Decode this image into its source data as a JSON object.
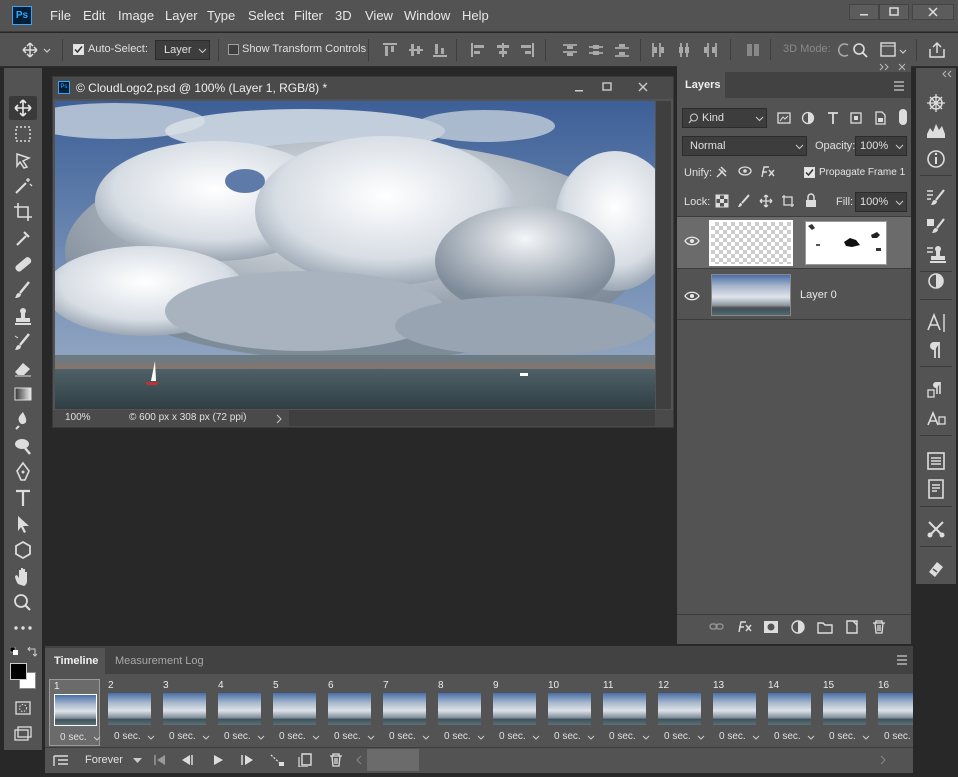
{
  "app": {
    "logo": "Ps"
  },
  "menubar": {
    "items": [
      "File",
      "Edit",
      "Image",
      "Layer",
      "Type",
      "Select",
      "Filter",
      "3D",
      "View",
      "Window",
      "Help"
    ]
  },
  "window_controls": {
    "minimize": "minimize-icon",
    "maximize": "maximize-icon",
    "close": "close-icon"
  },
  "options_bar": {
    "auto_select_label": "Auto-Select:",
    "auto_select_checked": true,
    "auto_select_target": "Layer",
    "show_transform_label": "Show Transform Controls",
    "mode_3d_label": "3D Mode:"
  },
  "document": {
    "title": "© CloudLogo2.psd @ 100% (Layer 1, RGB/8) *",
    "zoom": "100%",
    "info": "© 600 px x 308 px (72 ppi)"
  },
  "layers_panel": {
    "tab": "Layers",
    "filter_kind": "Kind",
    "blend_mode": "Normal",
    "opacity_label": "Opacity:",
    "opacity_value": "100%",
    "unify_label": "Unify:",
    "propagate_label": "Propagate Frame 1",
    "propagate_checked": true,
    "lock_label": "Lock:",
    "fill_label": "Fill:",
    "fill_value": "100%",
    "layers": [
      {
        "name": "",
        "visible": true,
        "has_mask": true,
        "selected": true
      },
      {
        "name": "Layer 0",
        "visible": true,
        "has_mask": false,
        "selected": false
      }
    ]
  },
  "timeline": {
    "tabs": [
      "Timeline",
      "Measurement Log"
    ],
    "active_tab": "Timeline",
    "loop": "Forever",
    "frames": [
      {
        "num": "1",
        "time": "0 sec."
      },
      {
        "num": "2",
        "time": "0 sec."
      },
      {
        "num": "3",
        "time": "0 sec."
      },
      {
        "num": "4",
        "time": "0 sec."
      },
      {
        "num": "5",
        "time": "0 sec."
      },
      {
        "num": "6",
        "time": "0 sec."
      },
      {
        "num": "7",
        "time": "0 sec."
      },
      {
        "num": "8",
        "time": "0 sec."
      },
      {
        "num": "9",
        "time": "0 sec."
      },
      {
        "num": "10",
        "time": "0 sec."
      },
      {
        "num": "11",
        "time": "0 sec."
      },
      {
        "num": "12",
        "time": "0 sec."
      },
      {
        "num": "13",
        "time": "0 sec."
      },
      {
        "num": "14",
        "time": "0 sec."
      },
      {
        "num": "15",
        "time": "0 sec."
      },
      {
        "num": "16",
        "time": "0 sec."
      }
    ]
  },
  "colors": {
    "panel": "#535353",
    "workspace": "#282828",
    "dark_field": "#3d3d3d",
    "accent_blue": "#31a8ff"
  }
}
